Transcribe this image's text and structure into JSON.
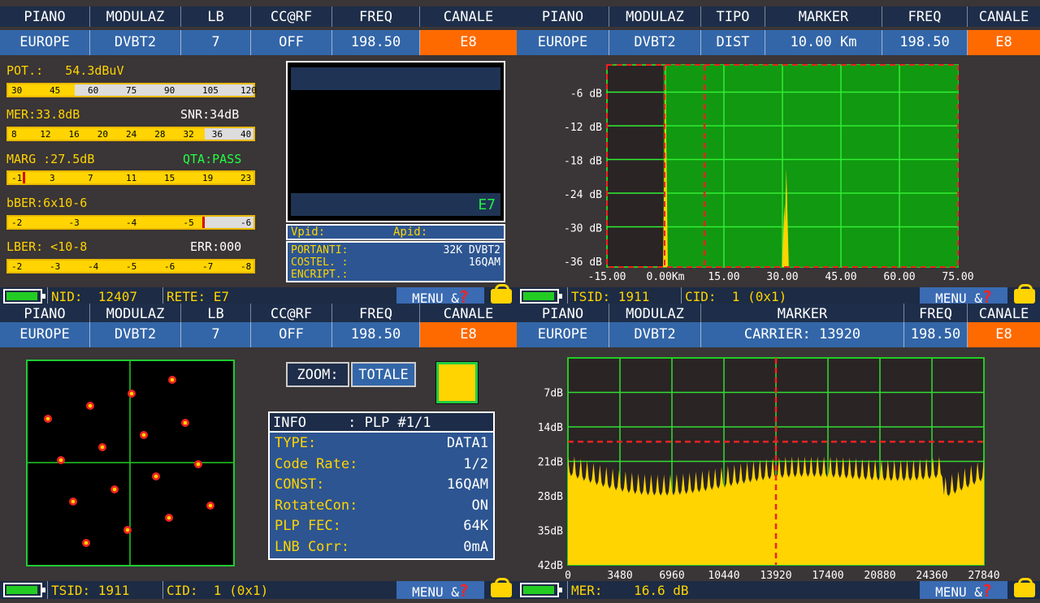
{
  "colors": {
    "accent_orange": "#ff6a00",
    "header_blue": "#1e2e4a",
    "value_blue": "#3366a8",
    "meter_yellow": "#ffd400",
    "grid_green": "#22cc22"
  },
  "q1": {
    "hdr": [
      "PIANO",
      "MODULAZ",
      "LB",
      "CC@RF",
      "FREQ",
      "CANALE"
    ],
    "vals": [
      "EUROPE",
      "DVBT2",
      "7",
      "OFF",
      "198.50",
      "E8"
    ],
    "meas": {
      "pot": "POT.:   54.3dBuV",
      "mer": "MER:33.8dB",
      "snr": "SNR:34dB",
      "marg": "MARG :27.5dB",
      "qta": "QTA:PASS",
      "bber": "bBER:6x10-6",
      "lber": "LBER: <10-8",
      "err": "ERR:000"
    },
    "bars": {
      "pot": {
        "ticks": [
          "30",
          "45",
          "60",
          "75",
          "90",
          "105",
          "120"
        ],
        "fill": 0.27
      },
      "mer": {
        "ticks": [
          "8",
          "12",
          "16",
          "20",
          "24",
          "28",
          "32",
          "36",
          "40"
        ],
        "fill": 0.8
      },
      "marg": {
        "ticks": [
          "-1",
          "3",
          "7",
          "11",
          "15",
          "19",
          "23"
        ],
        "fill": 1.0,
        "marker": 0.06
      },
      "bber": {
        "ticks": [
          "-2",
          "-3",
          "-4",
          "-5",
          "-6"
        ],
        "fill": 0.79,
        "marker": 0.79
      },
      "lber": {
        "ticks": [
          "-2",
          "-3",
          "-4",
          "-5",
          "-6",
          "-7",
          "-8"
        ],
        "fill": 1.0
      }
    },
    "video_channel": "E7",
    "vpid": "Vpid:",
    "apid": "Apid:",
    "info": [
      {
        "k": "PORTANTI:",
        "v": "32K DVBT2"
      },
      {
        "k": "COSTEL. :",
        "v": "16QAM"
      },
      {
        "k": "ENCRIPT.:",
        "v": ""
      }
    ],
    "foot": {
      "f1": "NID:  12407",
      "f2": "RETE: E7",
      "menu": "MENU &"
    }
  },
  "q2": {
    "hdr": [
      "PIANO",
      "MODULAZ",
      "TIPO",
      "MARKER",
      "FREQ",
      "CANALE"
    ],
    "vals": [
      "EUROPE",
      "DVBT2",
      "DIST",
      "10.00 Km",
      "198.50",
      "E8"
    ],
    "foot": {
      "f1": "TSID: 1911",
      "f2": "CID:  1 (0x1)",
      "menu": "MENU &"
    }
  },
  "q3": {
    "hdr": [
      "PIANO",
      "MODULAZ",
      "LB",
      "CC@RF",
      "FREQ",
      "CANALE"
    ],
    "vals": [
      "EUROPE",
      "DVBT2",
      "7",
      "OFF",
      "198.50",
      "E8"
    ],
    "zoom_label": "ZOOM:",
    "zoom_value": "TOTALE",
    "plp_header": "INFO     : PLP #1/1",
    "plp": [
      {
        "k": "TYPE:",
        "v": "DATA1"
      },
      {
        "k": "Code Rate:",
        "v": "1/2"
      },
      {
        "k": "CONST:",
        "v": "16QAM"
      },
      {
        "k": "RotateCon:",
        "v": "ON"
      },
      {
        "k": "PLP FEC:",
        "v": "64K"
      },
      {
        "k": "LNB Corr:",
        "v": "0mA"
      }
    ],
    "foot": {
      "f1": "TSID: 1911",
      "f2": "CID:  1 (0x1)",
      "menu": "MENU &"
    }
  },
  "q4": {
    "hdr": [
      "PIANO",
      "MODULAZ",
      "MARKER",
      "FREQ",
      "CANALE"
    ],
    "vals": [
      "EUROPE",
      "DVBT2",
      "CARRIER: 13920",
      "198.50",
      "E8"
    ],
    "foot": {
      "f1": "MER:    16.6 dB",
      "menu": "MENU &"
    }
  },
  "chart_data": [
    {
      "type": "bar",
      "title": "",
      "x_ticks": [
        "-15.00",
        "0.00Km",
        "15.00",
        "30.00",
        "45.00",
        "60.00",
        "75.00"
      ],
      "y_ticks": [
        "-6 dB",
        "-12 dB",
        "-18 dB",
        "-24 dB",
        "-30 dB",
        "-36 dB"
      ],
      "xlim": [
        -15,
        75
      ],
      "ylim": [
        -39,
        0
      ],
      "marker": 10.0,
      "echo_peaks": [
        {
          "x": 0.0,
          "y": -2
        },
        {
          "x": 31.0,
          "y": -20
        },
        {
          "x": 30.5,
          "y": -27
        }
      ]
    },
    {
      "type": "area",
      "title": "",
      "x_ticks": [
        "0",
        "3480",
        "6960",
        "10440",
        "13920",
        "17400",
        "20880",
        "24360",
        "27840"
      ],
      "y_ticks": [
        "7dB",
        "14dB",
        "21dB",
        "28dB",
        "35dB",
        "42dB"
      ],
      "xlim": [
        0,
        27840
      ],
      "ylim": [
        0,
        42
      ],
      "marker_x": 13920,
      "threshold_db": 17
    }
  ],
  "constellation": {
    "points": [
      [
        212,
        468
      ],
      [
        111,
        500
      ],
      [
        162,
        485
      ],
      [
        59,
        516
      ],
      [
        228,
        521
      ],
      [
        126,
        551
      ],
      [
        177,
        536
      ],
      [
        75,
        567
      ],
      [
        244,
        572
      ],
      [
        141,
        603
      ],
      [
        192,
        587
      ],
      [
        90,
        618
      ],
      [
        259,
        623
      ],
      [
        157,
        653
      ],
      [
        208,
        638
      ],
      [
        106,
        669
      ]
    ]
  }
}
